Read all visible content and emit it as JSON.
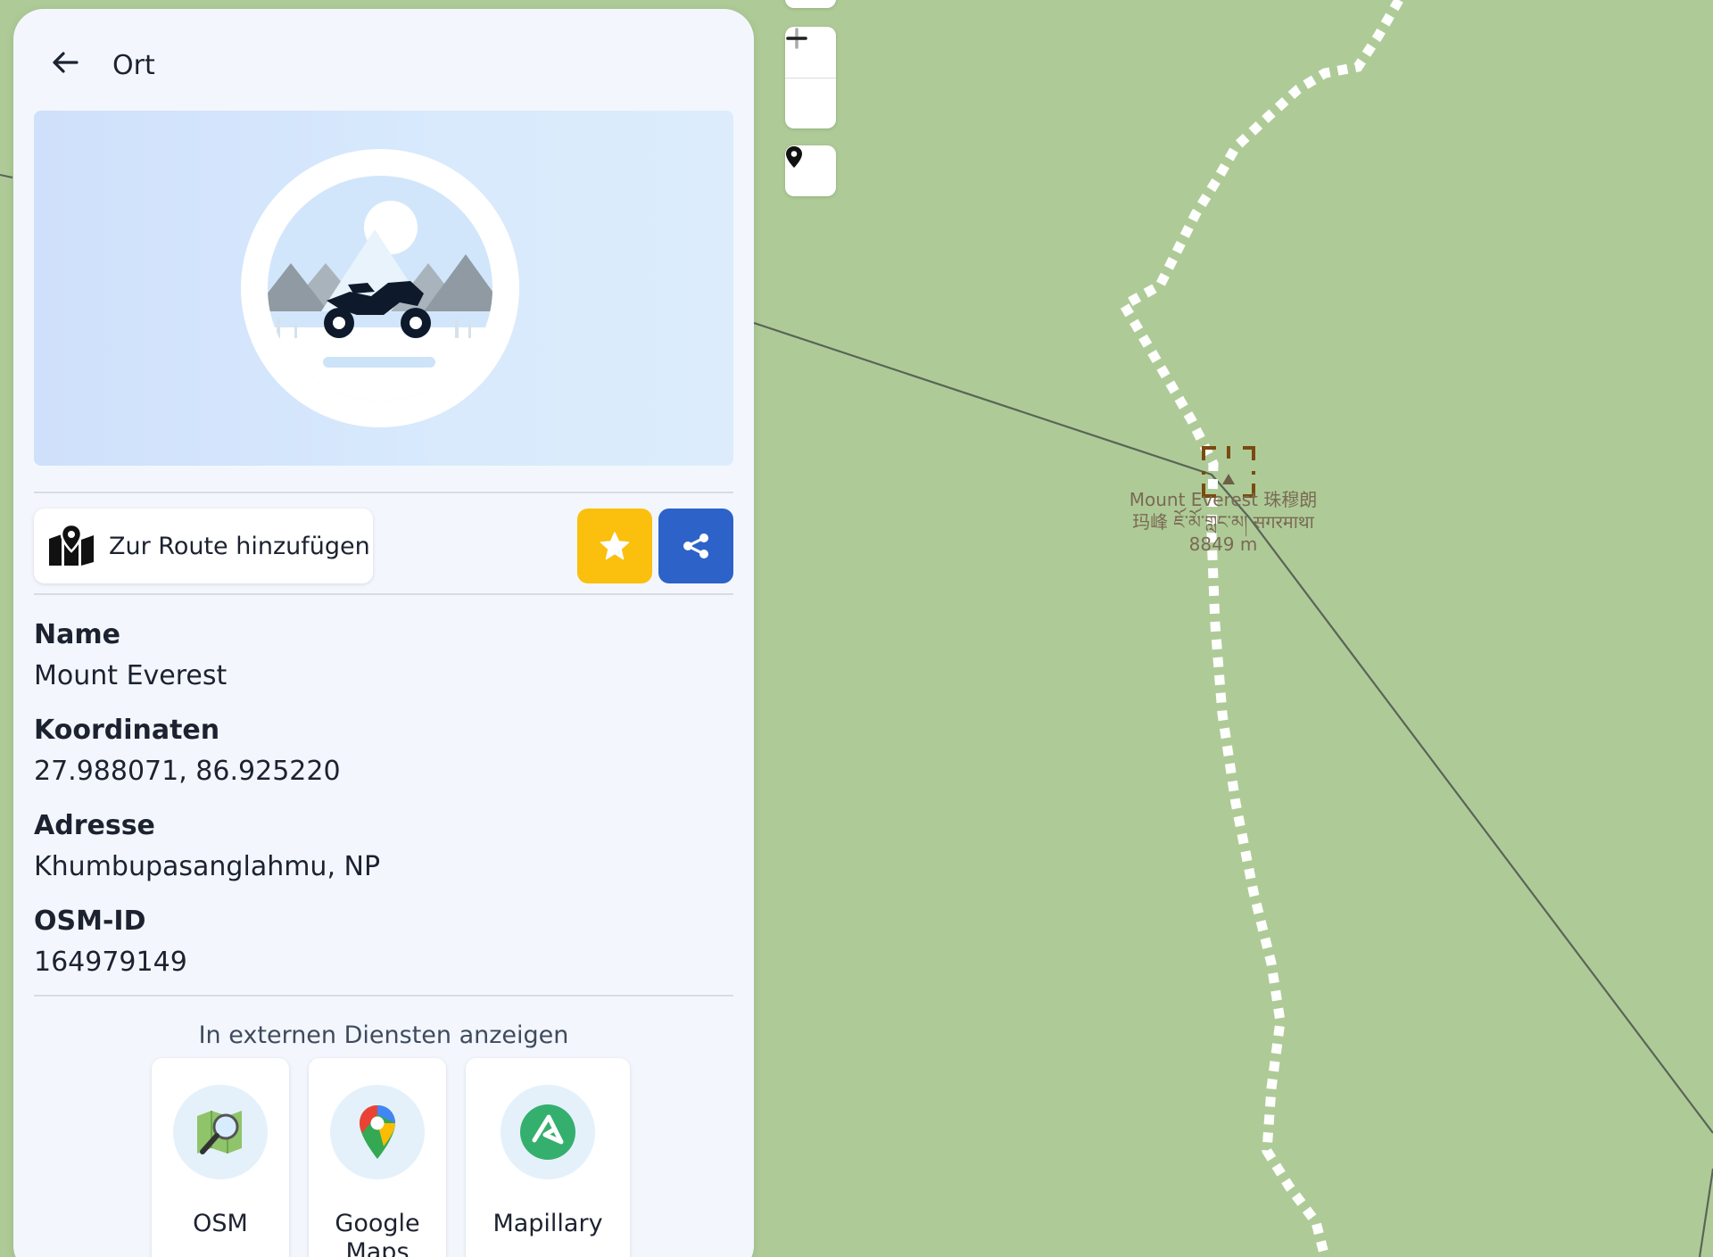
{
  "map": {
    "peak": {
      "name_line1": "Mount Everest 珠穆朗",
      "name_line2": "玛峰 ཇོ་མོ་གླང་མ། सगरमाथा",
      "elevation": "8849 m"
    },
    "controls": {
      "zoom_in": "+",
      "zoom_out": "−"
    },
    "colors": {
      "land": "#aecb97",
      "trail": "#ffffff",
      "border_line": "#5a6458",
      "peak_marker": "#7a4a10"
    }
  },
  "panel": {
    "header": {
      "title": "Ort"
    },
    "actions": {
      "add_to_route": "Zur Route hinzufügen"
    },
    "fields": [
      {
        "label": "Name",
        "value": "Mount Everest"
      },
      {
        "label": "Koordinaten",
        "value": "27.988071, 86.925220"
      },
      {
        "label": "Adresse",
        "value": "Khumbupasanglahmu, NP"
      },
      {
        "label": "OSM-ID",
        "value": "164979149"
      }
    ],
    "external": {
      "title": "In externen Diensten anzeigen",
      "services": [
        {
          "label": "OSM",
          "icon": "osm-magnifier-icon"
        },
        {
          "label": "Google Maps",
          "icon": "google-maps-pin-icon"
        },
        {
          "label": "Mapillary",
          "icon": "mapillary-icon"
        }
      ]
    },
    "colors": {
      "favorite": "#fbbf0e",
      "share": "#2d63c8"
    }
  }
}
